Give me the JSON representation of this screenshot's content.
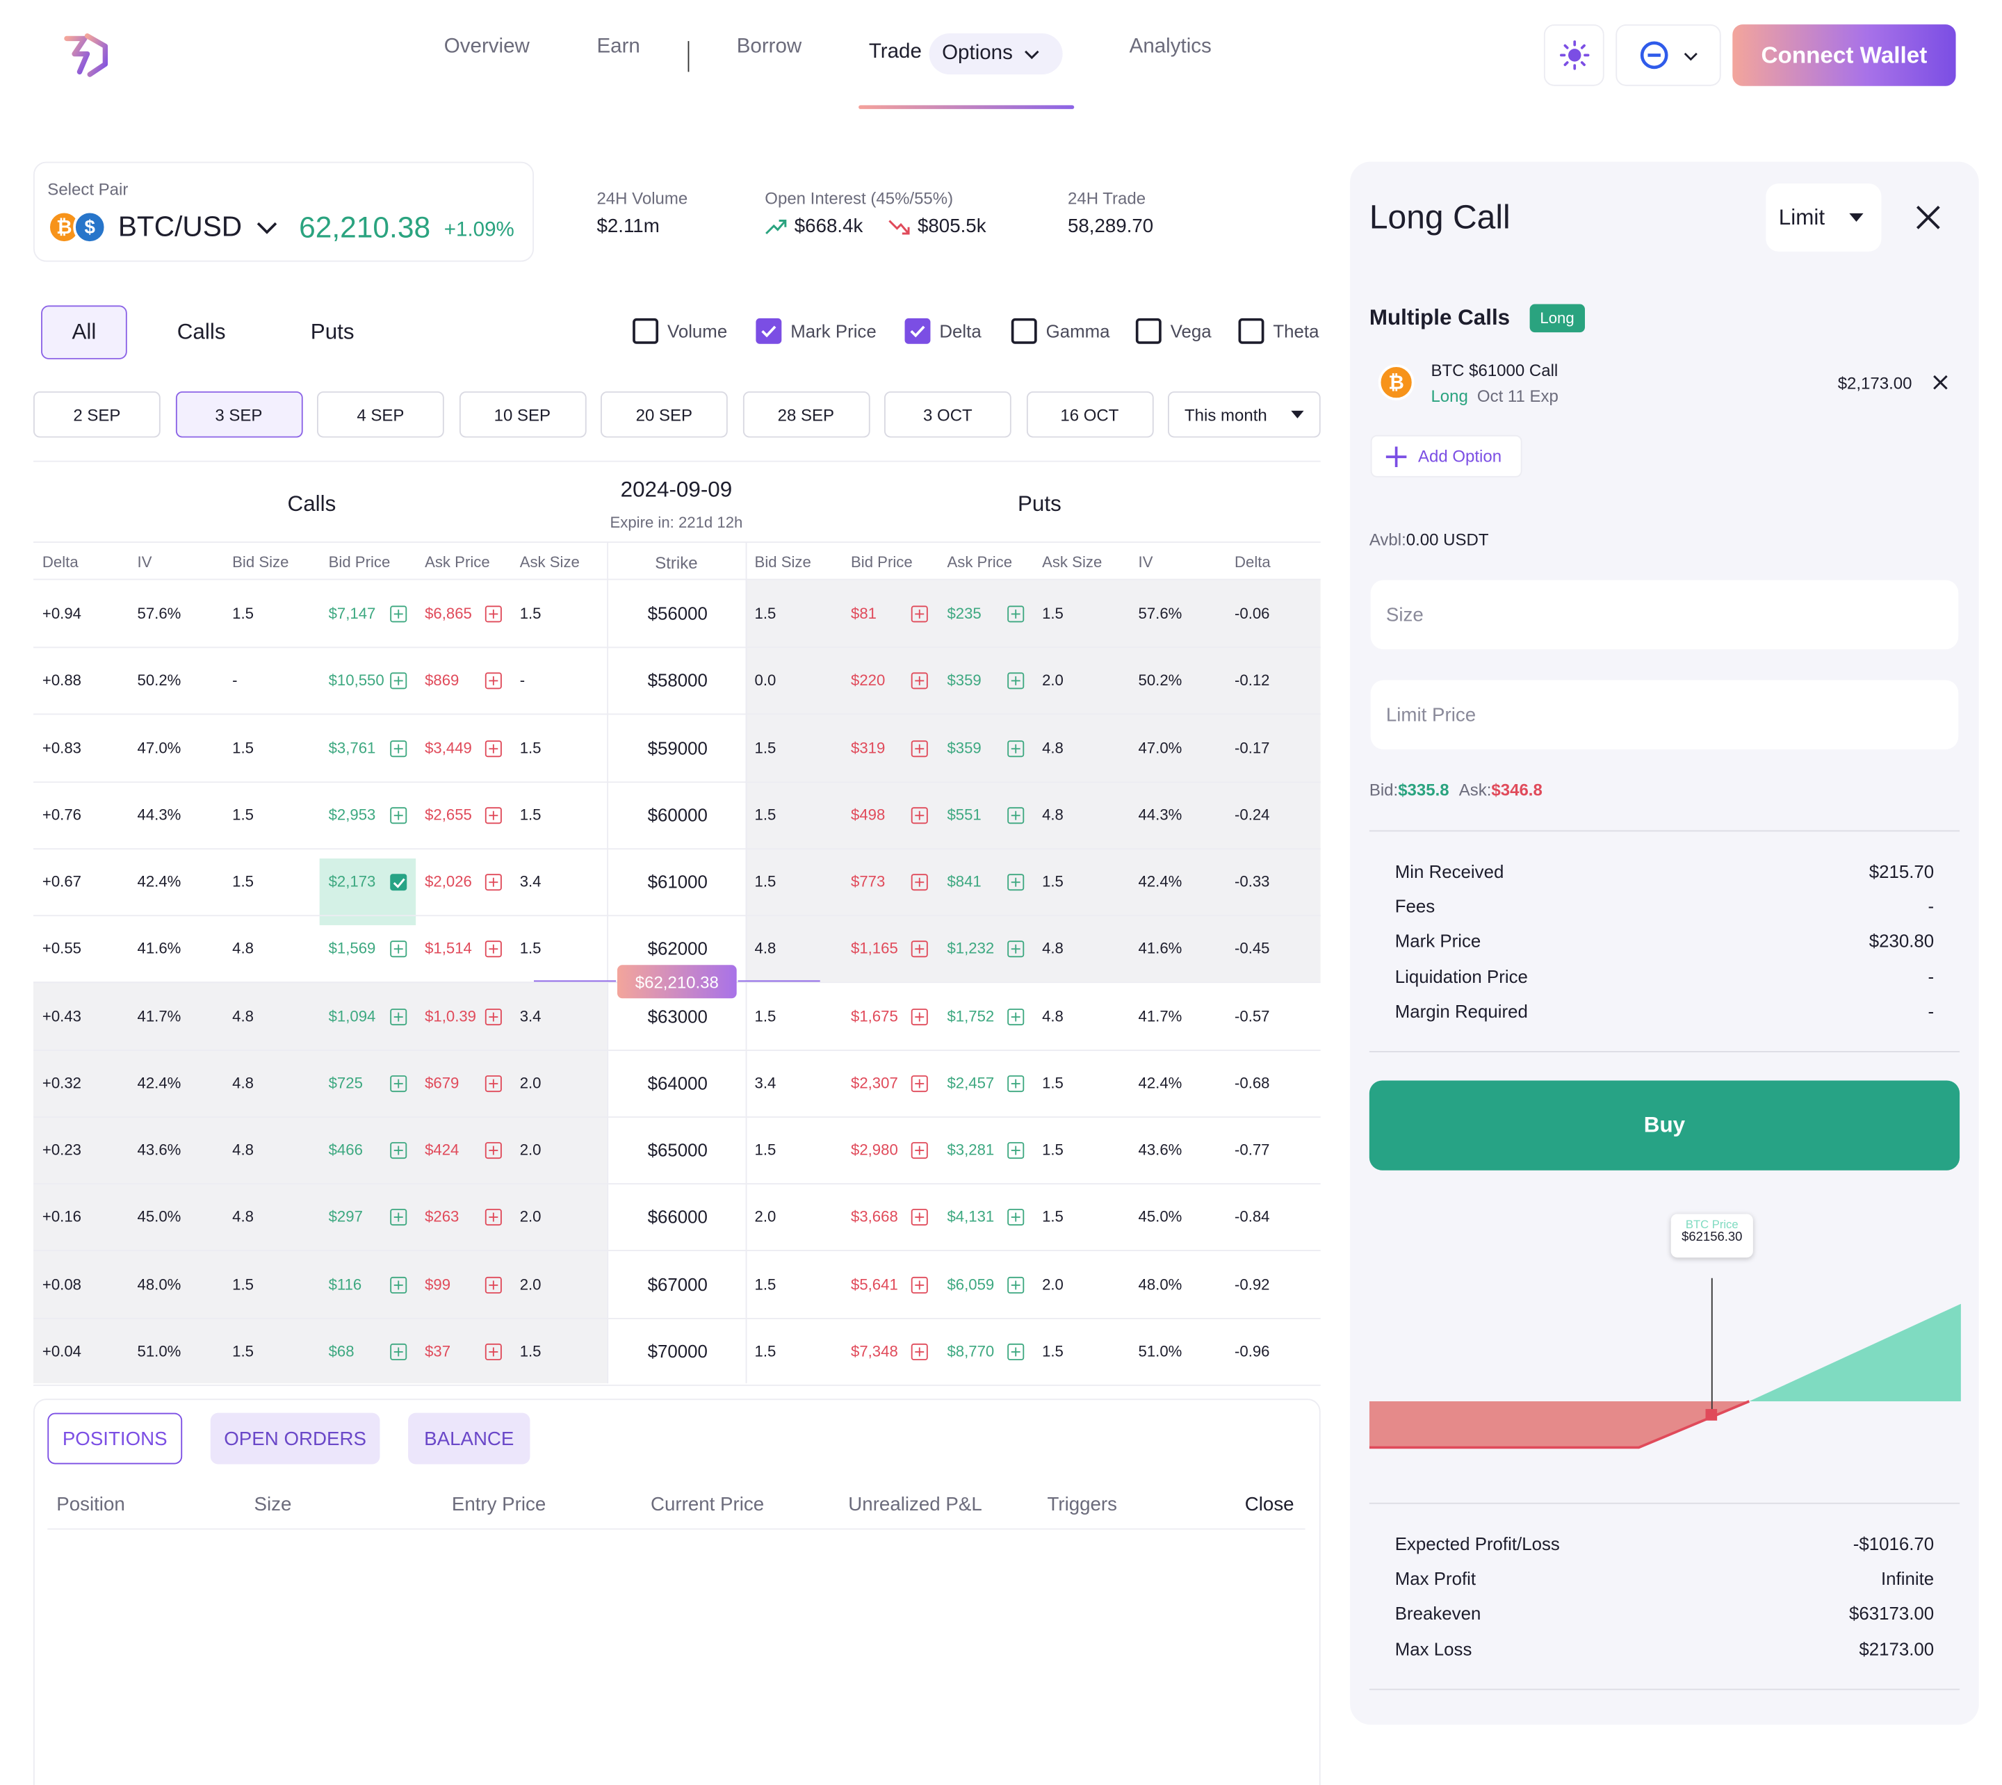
{
  "nav": {
    "items": [
      "Overview",
      "Earn",
      "Borrow",
      "Analytics"
    ],
    "trade_label": "Trade",
    "options_label": "Options",
    "connect_label": "Connect Wallet"
  },
  "pair": {
    "select_label": "Select Pair",
    "name": "BTC/USD",
    "price": "62,210.38",
    "change": "+1.09%"
  },
  "stats": [
    {
      "label": "24H Volume",
      "value": "$2.11m"
    },
    {
      "label": "Open Interest (45%/55%)",
      "up": "$668.4k",
      "down": "$805.5k"
    },
    {
      "label": "24H Trade",
      "value": "58,289.70"
    }
  ],
  "filters": {
    "tabs": [
      "All",
      "Calls",
      "Puts"
    ],
    "checks": [
      {
        "label": "Volume",
        "on": false
      },
      {
        "label": "Mark Price",
        "on": true
      },
      {
        "label": "Delta",
        "on": true
      },
      {
        "label": "Gamma",
        "on": false
      },
      {
        "label": "Vega",
        "on": false
      },
      {
        "label": "Theta",
        "on": false
      }
    ]
  },
  "dates": [
    "2 SEP",
    "3 SEP",
    "4 SEP",
    "10 SEP",
    "20 SEP",
    "28 SEP",
    "3 OCT",
    "16 OCT"
  ],
  "dates_select": "This month",
  "chain": {
    "calls_title": "Calls",
    "puts_title": "Puts",
    "expiry_date": "2024-09-09",
    "expire_in": "Expire in: 221d 12h",
    "call_headers": [
      "Delta",
      "IV",
      "Bid Size",
      "Bid Price",
      "Ask Price",
      "Ask Size"
    ],
    "strike_header": "Strike",
    "put_headers": [
      "Bid Size",
      "Bid Price",
      "Ask Price",
      "Ask Size",
      "IV",
      "Delta"
    ],
    "current_price": "$62,210.38",
    "rows": [
      {
        "c": [
          "+0.94",
          "57.6%",
          "1.5",
          "$7,147",
          "$6,865",
          "1.5"
        ],
        "strike": "$56000",
        "p": [
          "1.5",
          "$81",
          "$235",
          "1.5",
          "57.6%",
          "-0.06"
        ]
      },
      {
        "c": [
          "+0.88",
          "50.2%",
          "-",
          "$10,550",
          "$869",
          "-"
        ],
        "strike": "$58000",
        "p": [
          "0.0",
          "$220",
          "$359",
          "2.0",
          "50.2%",
          "-0.12"
        ]
      },
      {
        "c": [
          "+0.83",
          "47.0%",
          "1.5",
          "$3,761",
          "$3,449",
          "1.5"
        ],
        "strike": "$59000",
        "p": [
          "1.5",
          "$319",
          "$359",
          "4.8",
          "47.0%",
          "-0.17"
        ]
      },
      {
        "c": [
          "+0.76",
          "44.3%",
          "1.5",
          "$2,953",
          "$2,655",
          "1.5"
        ],
        "strike": "$60000",
        "p": [
          "1.5",
          "$498",
          "$551",
          "4.8",
          "44.3%",
          "-0.24"
        ]
      },
      {
        "c": [
          "+0.67",
          "42.4%",
          "1.5",
          "$2,173",
          "$2,026",
          "3.4"
        ],
        "strike": "$61000",
        "p": [
          "1.5",
          "$773",
          "$841",
          "1.5",
          "42.4%",
          "-0.33"
        ]
      },
      {
        "c": [
          "+0.55",
          "41.6%",
          "4.8",
          "$1,569",
          "$1,514",
          "1.5"
        ],
        "strike": "$62000",
        "p": [
          "4.8",
          "$1,165",
          "$1,232",
          "4.8",
          "41.6%",
          "-0.45"
        ]
      },
      {
        "c": [
          "+0.43",
          "41.7%",
          "4.8",
          "$1,094",
          "$1,0.39",
          "3.4"
        ],
        "strike": "$63000",
        "p": [
          "1.5",
          "$1,675",
          "$1,752",
          "4.8",
          "41.7%",
          "-0.57"
        ]
      },
      {
        "c": [
          "+0.32",
          "42.4%",
          "4.8",
          "$725",
          "$679",
          "2.0"
        ],
        "strike": "$64000",
        "p": [
          "3.4",
          "$2,307",
          "$2,457",
          "1.5",
          "42.4%",
          "-0.68"
        ]
      },
      {
        "c": [
          "+0.23",
          "43.6%",
          "4.8",
          "$466",
          "$424",
          "2.0"
        ],
        "strike": "$65000",
        "p": [
          "1.5",
          "$2,980",
          "$3,281",
          "1.5",
          "43.6%",
          "-0.77"
        ]
      },
      {
        "c": [
          "+0.16",
          "45.0%",
          "4.8",
          "$297",
          "$263",
          "2.0"
        ],
        "strike": "$66000",
        "p": [
          "2.0",
          "$3,668",
          "$4,131",
          "1.5",
          "45.0%",
          "-0.84"
        ]
      },
      {
        "c": [
          "+0.08",
          "48.0%",
          "1.5",
          "$116",
          "$99",
          "2.0"
        ],
        "strike": "$67000",
        "p": [
          "1.5",
          "$5,641",
          "$6,059",
          "2.0",
          "48.0%",
          "-0.92"
        ]
      },
      {
        "c": [
          "+0.04",
          "51.0%",
          "1.5",
          "$68",
          "$37",
          "1.5"
        ],
        "strike": "$70000",
        "p": [
          "1.5",
          "$7,348",
          "$8,770",
          "1.5",
          "51.0%",
          "-0.96"
        ]
      }
    ]
  },
  "positions": {
    "tabs": [
      "POSITIONS",
      "OPEN ORDERS",
      "BALANCE"
    ],
    "headers": [
      "Position",
      "Size",
      "Entry Price",
      "Current Price",
      "Unrealized P&L",
      "Triggers",
      "Close"
    ]
  },
  "panel": {
    "title": "Long Call",
    "order_type": "Limit",
    "section_title": "Multiple Calls",
    "section_badge": "Long",
    "leg_name": "BTC $61000 Call",
    "leg_side": "Long",
    "leg_exp": "Oct 11 Exp",
    "leg_price": "$2,173.00",
    "add_option": "Add Option",
    "avbl_label": "Avbl:",
    "avbl_value": "0.00 USDT",
    "size_placeholder": "Size",
    "limit_placeholder": "Limit Price",
    "bid_label": "Bid:",
    "bid_value": "$335.8",
    "ask_label": "Ask:",
    "ask_value": "$346.8",
    "details": [
      {
        "k": "Min Received",
        "v": "$215.70"
      },
      {
        "k": "Fees",
        "v": "-"
      },
      {
        "k": "Mark Price",
        "v": "$230.80"
      },
      {
        "k": "Liquidation Price",
        "v": "-"
      },
      {
        "k": "Margin Required",
        "v": "-"
      }
    ],
    "buy_label": "Buy",
    "chart_tooltip_label": "BTC Price",
    "chart_tooltip_value": "$62156.30",
    "summary": [
      {
        "k": "Expected Profit/Loss",
        "v": "-$1016.70"
      },
      {
        "k": "Max Profit",
        "v": "Infinite"
      },
      {
        "k": "Breakeven",
        "v": "$63173.00"
      },
      {
        "k": "Max Loss",
        "v": "$2173.00"
      }
    ]
  },
  "colors": {
    "accent": "#7b4ee4",
    "green": "#27a385",
    "red": "#e04a5a"
  }
}
